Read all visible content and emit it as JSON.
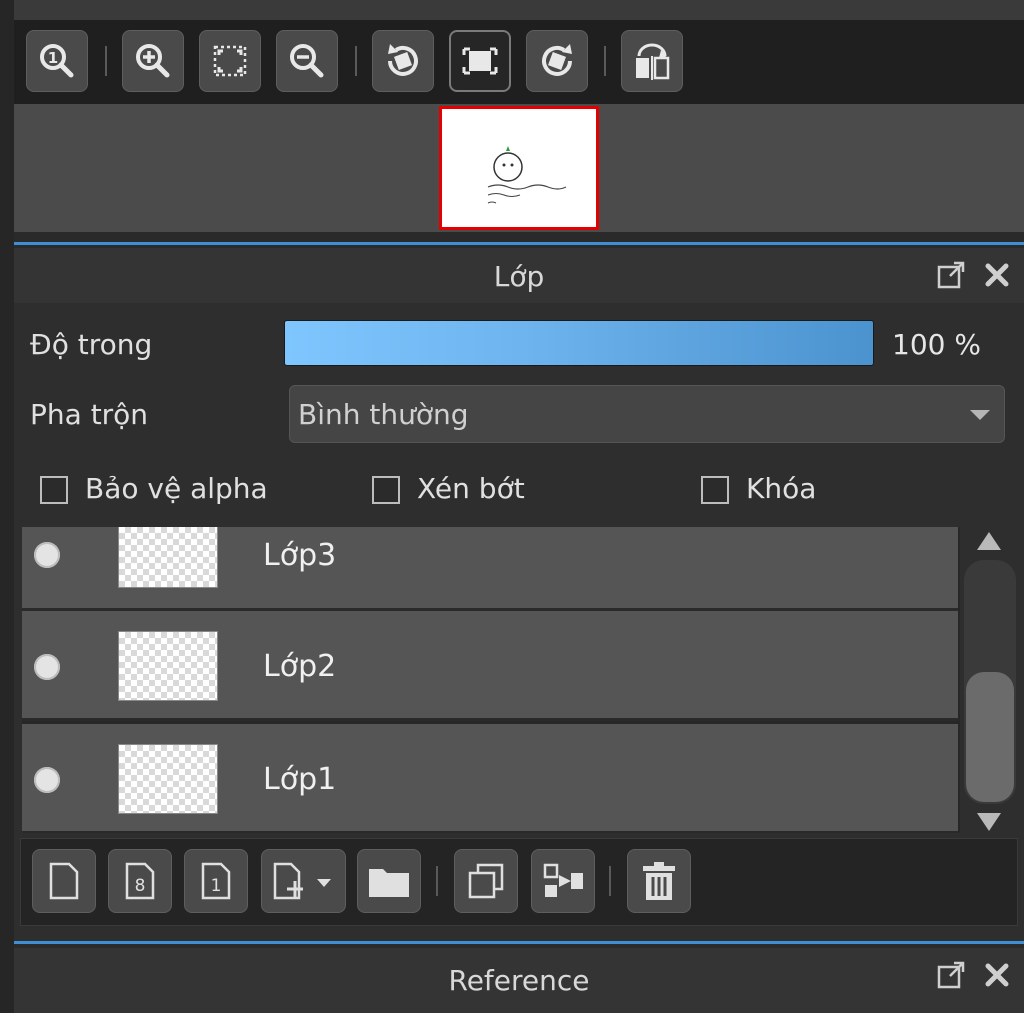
{
  "navigator": {
    "toolbar": [
      {
        "name": "actual-size-button",
        "icon": "zoom-actual-icon"
      },
      {
        "name": "zoom-in-button",
        "icon": "zoom-in-icon"
      },
      {
        "name": "fit-window-button",
        "icon": "fit-window-icon"
      },
      {
        "name": "zoom-out-button",
        "icon": "zoom-out-icon"
      },
      {
        "name": "rotate-left-button",
        "icon": "rotate-left-icon"
      },
      {
        "name": "reset-view-button",
        "icon": "reset-view-icon"
      },
      {
        "name": "rotate-right-button",
        "icon": "rotate-right-icon"
      },
      {
        "name": "flip-horizontal-button",
        "icon": "flip-horizontal-icon"
      }
    ],
    "accent_color": "#3f8fd6",
    "viewport_color": "#e30000"
  },
  "layer_panel": {
    "title": "Lớp",
    "opacity_label": "Độ trong",
    "opacity_value": "100 %",
    "opacity_fraction": 1.0,
    "blend_label": "Pha trộn",
    "blend_value": "Bình thường",
    "checkboxes": [
      {
        "label": "Bảo vệ alpha",
        "checked": false
      },
      {
        "label": "Xén bớt",
        "checked": false
      },
      {
        "label": "Khóa",
        "checked": false
      }
    ],
    "layers": [
      {
        "name": "Lớp3",
        "visible": true
      },
      {
        "name": "Lớp2",
        "visible": true
      },
      {
        "name": "Lớp1",
        "visible": true
      }
    ],
    "toolbar": [
      "new-layer-icon",
      "new-8bit-layer-icon",
      "new-1bit-layer-icon",
      "add-layer-dropdown-icon",
      "folder-icon",
      "duplicate-icon",
      "merge-down-icon",
      "trash-icon"
    ]
  },
  "reference_panel": {
    "title": "Reference"
  }
}
